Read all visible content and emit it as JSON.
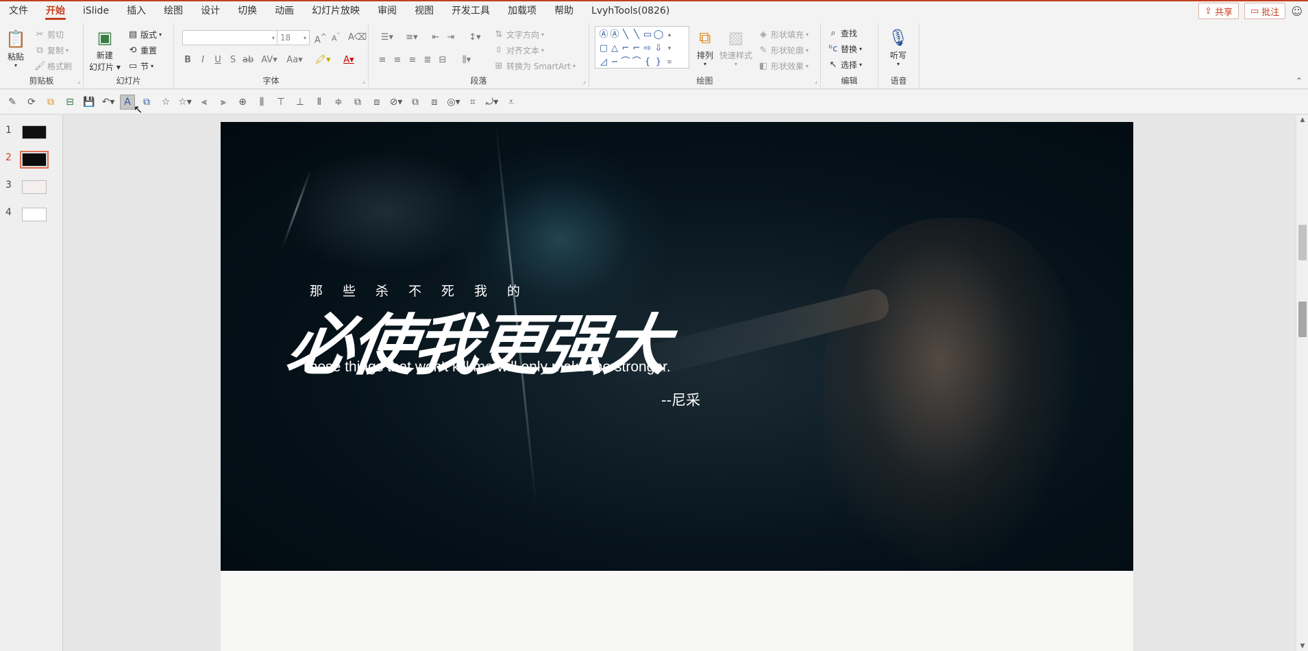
{
  "menu": {
    "tabs": [
      "文件",
      "开始",
      "iSlide",
      "插入",
      "绘图",
      "设计",
      "切换",
      "动画",
      "幻灯片放映",
      "审阅",
      "视图",
      "开发工具",
      "加载项",
      "帮助",
      "LvyhTools(0826)"
    ],
    "active_index": 1,
    "share_label": "共享",
    "comment_label": "批注"
  },
  "ribbon": {
    "clipboard": {
      "label": "剪贴板",
      "paste": "粘贴",
      "cut": "剪切",
      "copy": "复制",
      "format_painter": "格式刷"
    },
    "slides": {
      "label": "幻灯片",
      "new_slide_1": "新建",
      "new_slide_2": "幻灯片",
      "layout": "版式",
      "reset": "重置",
      "section": "节"
    },
    "font": {
      "label": "字体",
      "font_name": "",
      "font_size": "18",
      "bold": "B",
      "italic": "I",
      "underline": "U",
      "shadow": "S",
      "strike": "ab",
      "spacing": "AV",
      "case": "Aa",
      "grow": "A",
      "shrink": "A",
      "clear": "A"
    },
    "paragraph": {
      "label": "段落",
      "text_direction": "文字方向",
      "align_text": "对齐文本",
      "smartart": "转换为 SmartArt"
    },
    "drawing": {
      "label": "绘图",
      "arrange": "排列",
      "quick_styles": "快速样式",
      "shape_fill": "形状填充",
      "shape_outline": "形状轮廓",
      "shape_effects": "形状效果"
    },
    "editing": {
      "label": "编辑",
      "find": "查找",
      "replace": "替换",
      "select": "选择"
    },
    "voice": {
      "label": "语音",
      "dictate": "听写"
    }
  },
  "thumbnails": [
    {
      "num": "1",
      "selected": false,
      "tone": "#111"
    },
    {
      "num": "2",
      "selected": true,
      "tone": "#0b0b0b"
    },
    {
      "num": "3",
      "selected": false,
      "tone": "#f4eeee"
    },
    {
      "num": "4",
      "selected": false,
      "tone": "#ffffff"
    }
  ],
  "slide": {
    "subtitle": "那些杀不死我的",
    "headline": "必使我更强大",
    "english": "Those things that won't kill me will only make me stronger.",
    "author": "--尼采"
  },
  "colors": {
    "accent": "#c43e1c"
  }
}
